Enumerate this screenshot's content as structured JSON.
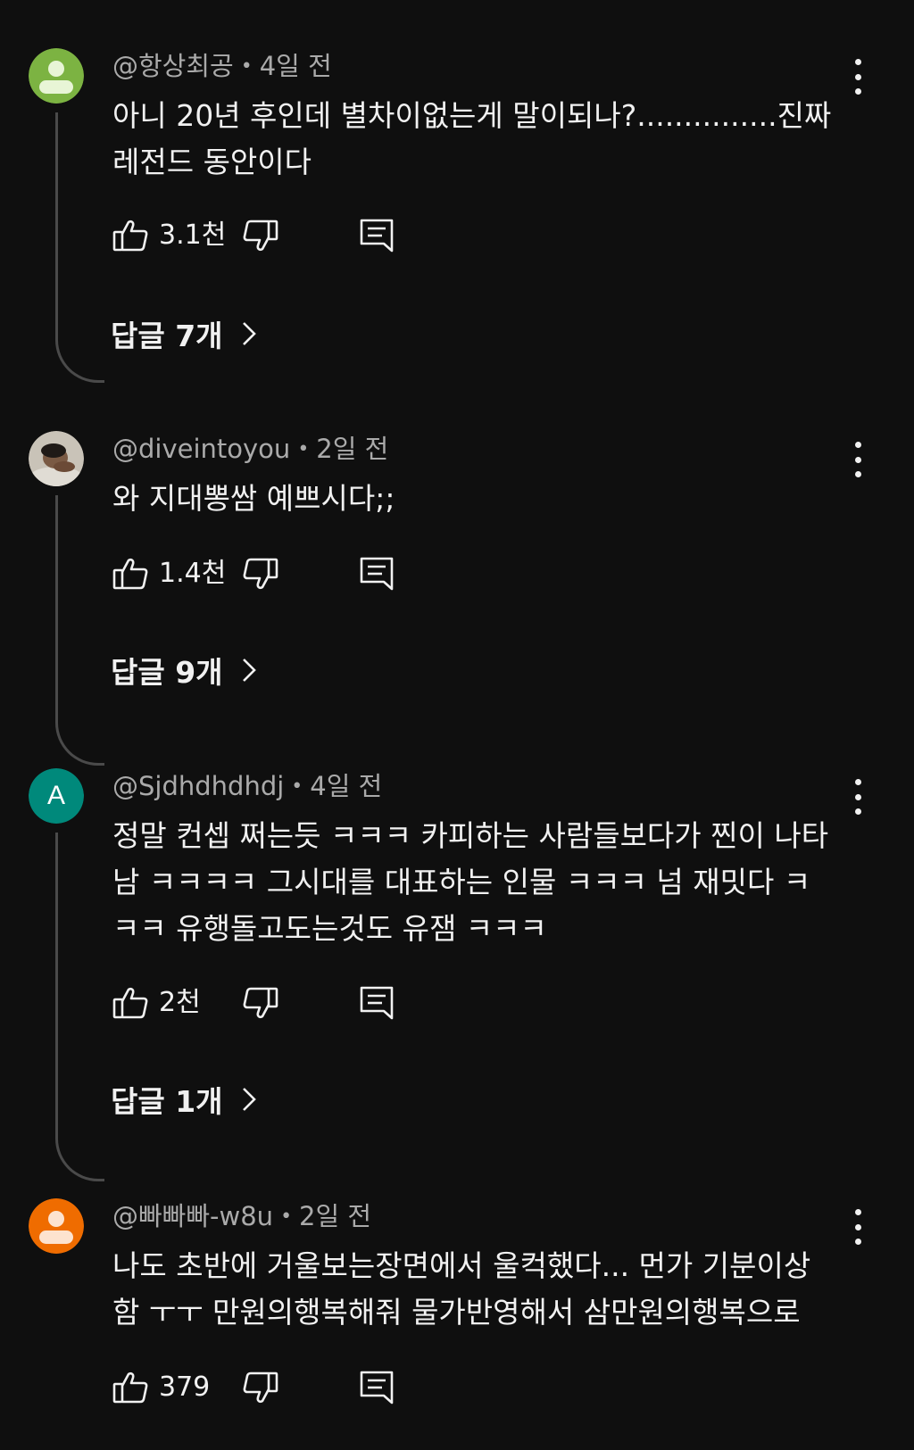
{
  "comments": [
    {
      "author": "@항상최공",
      "time": "4일 전",
      "text": "아니 20년 후인데 별차이없는게 말이되나?...............진짜 레전드 동안이다",
      "likes": "3.1천",
      "replies": "답글 7개",
      "avatar_color": "#7cb342",
      "avatar_type": "default-person-icon"
    },
    {
      "author": "@diveintoyou",
      "time": "2일 전",
      "text": "와 지대뽕쌈 예쁘시다;;",
      "likes": "1.4천",
      "replies": "답글 9개",
      "avatar_type": "photo"
    },
    {
      "author": "@Sjdhdhdhdj",
      "time": "4일 전",
      "text": "정말 컨셉 쩌는듯 ㅋㅋㅋ 카피하는 사람들보다가 찐이 나타남 ㅋㅋㅋㅋ 그시대를 대표하는 인물 ㅋㅋㅋ 넘 재밋다 ㅋㅋㅋ 유행돌고도는것도 유잼 ㅋㅋㅋ",
      "likes": "2천",
      "replies": "답글 1개",
      "avatar_letter": "A",
      "avatar_color": "#00897b",
      "avatar_type": "letter"
    },
    {
      "author": "@빠빠빠-w8u",
      "time": "2일 전",
      "text": "나도 초반에 거울보는장면에서 울컥했다... 먼가 기분이상함 ㅜㅜ 만원의행복해줘 물가반영해서 삼만원의행복으로",
      "likes": "379",
      "avatar_color": "#ef6c00",
      "avatar_type": "default-person-icon"
    }
  ],
  "colors": {
    "background": "#0f0f0f",
    "text_primary": "#f1f1f1",
    "text_secondary": "#aaaaaa",
    "thread_line": "#4a4a4a"
  }
}
